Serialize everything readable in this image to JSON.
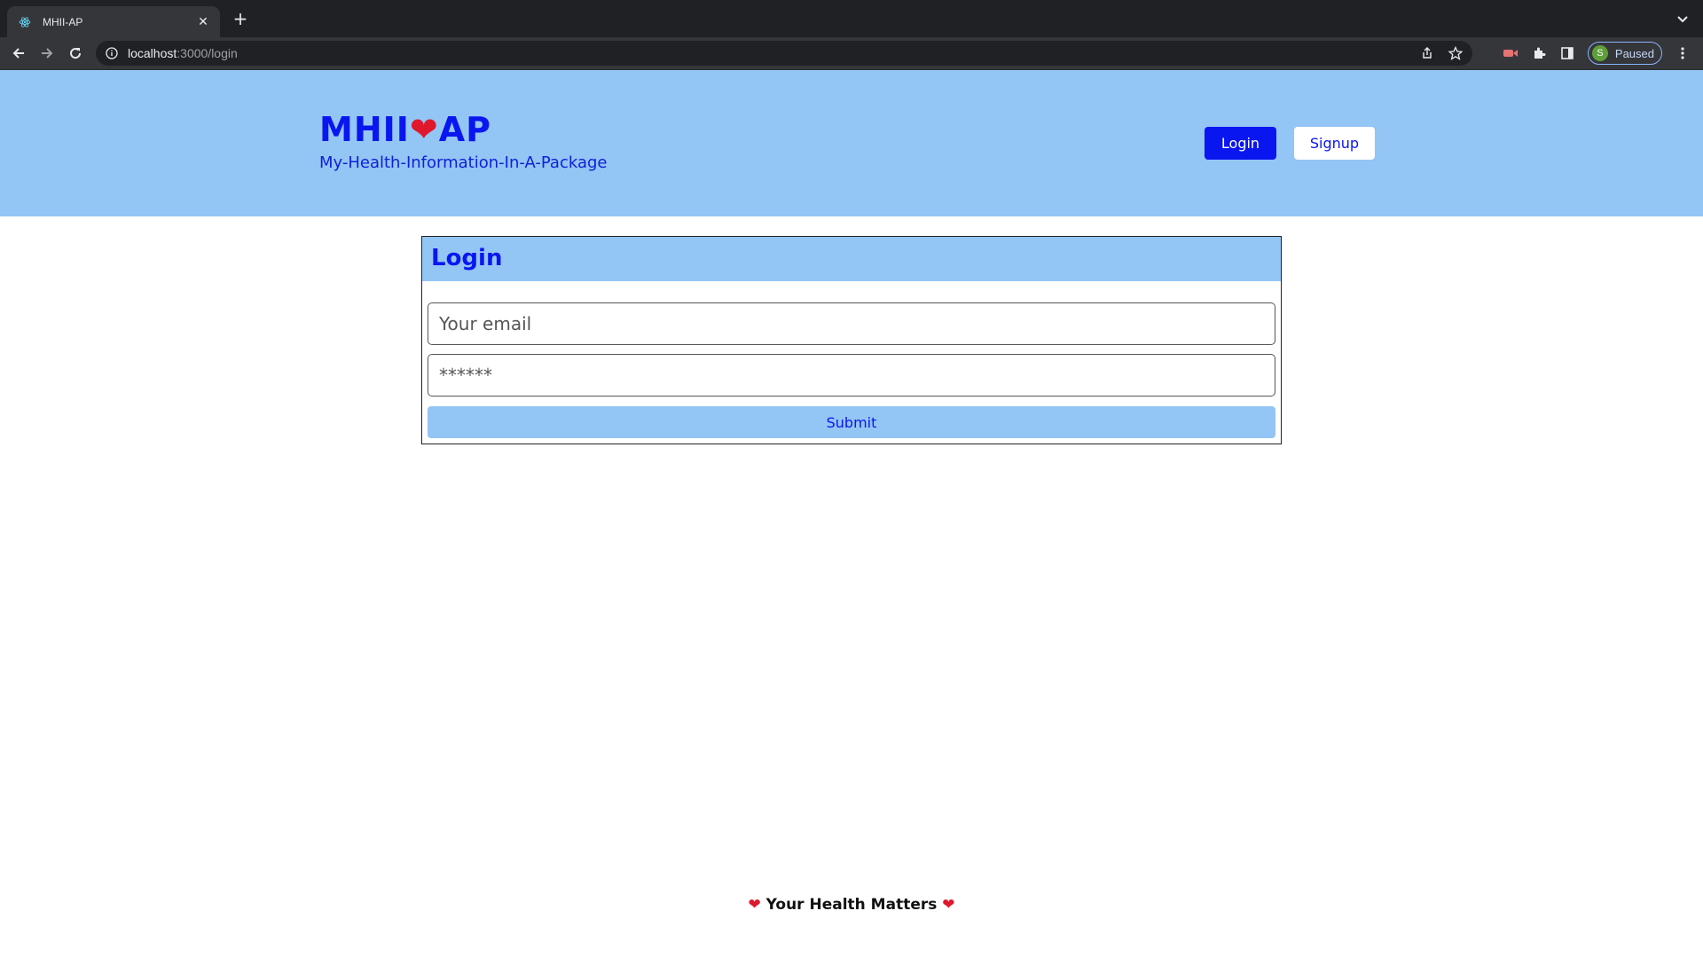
{
  "browser": {
    "tab_title": "MHII-AP",
    "url_host": "localhost",
    "url_path": ":3000/login",
    "profile_initial": "S",
    "profile_status": "Paused"
  },
  "header": {
    "brand_left": "MHII",
    "brand_heart": "❤",
    "brand_right": "AP",
    "subtitle": "My-Health-Information-In-A-Package",
    "login_label": "Login",
    "signup_label": "Signup"
  },
  "login_form": {
    "title": "Login",
    "email_placeholder": "Your email",
    "password_placeholder": "******",
    "submit_label": "Submit"
  },
  "footer": {
    "heart": "❤",
    "text": "Your Health Matters"
  },
  "colors": {
    "header_bg": "#93c5f5",
    "brand_blue": "#0a16f0",
    "heart_red": "#e0182d"
  }
}
